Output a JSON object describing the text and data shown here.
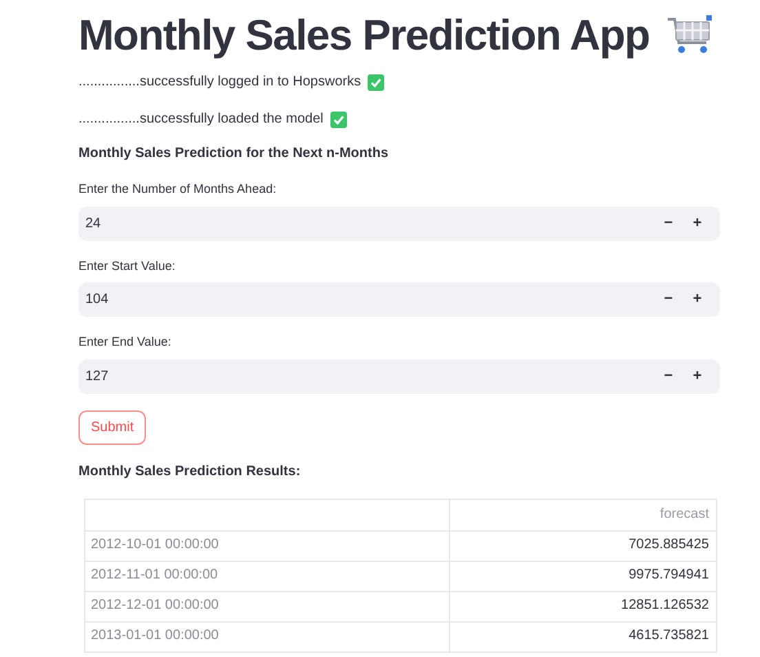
{
  "title": "Monthly Sales Prediction App",
  "messages": [
    {
      "text": "................successfully logged in to Hopsworks",
      "checked": true
    },
    {
      "text": "................successfully loaded the model",
      "checked": true
    }
  ],
  "section_heading": "Monthly Sales Prediction for the Next n-Months",
  "inputs": [
    {
      "label": "Enter the Number of Months Ahead:",
      "value": "24",
      "decrement": "−",
      "increment": "+"
    },
    {
      "label": "Enter Start Value:",
      "value": "104",
      "decrement": "−",
      "increment": "+"
    },
    {
      "label": "Enter End Value:",
      "value": "127",
      "decrement": "−",
      "increment": "+"
    }
  ],
  "submit_button": "Submit",
  "results_heading": "Monthly Sales Prediction Results:",
  "table": {
    "columns": [
      "forecast"
    ],
    "rows": [
      {
        "index": "2012-10-01 00:00:00",
        "forecast": "7025.885425"
      },
      {
        "index": "2012-11-01 00:00:00",
        "forecast": "9975.794941"
      },
      {
        "index": "2012-12-01 00:00:00",
        "forecast": "12851.126532"
      },
      {
        "index": "2013-01-01 00:00:00",
        "forecast": "4615.735821"
      }
    ]
  }
}
